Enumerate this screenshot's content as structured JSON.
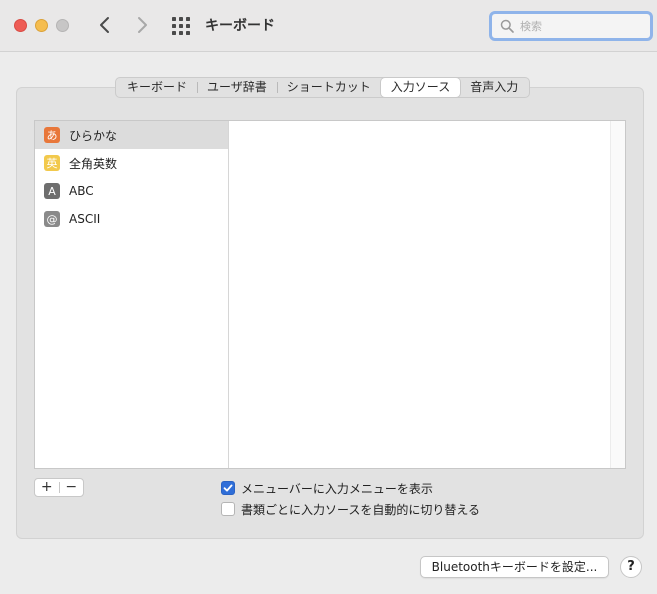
{
  "window": {
    "title": "キーボード"
  },
  "search": {
    "placeholder": "検索",
    "value": ""
  },
  "tabs": [
    {
      "label": "キーボード",
      "active": false
    },
    {
      "label": "ユーザ辞書",
      "active": false
    },
    {
      "label": "ショートカット",
      "active": false
    },
    {
      "label": "入力ソース",
      "active": true
    },
    {
      "label": "音声入力",
      "active": false
    }
  ],
  "input_sources": [
    {
      "label": "ひらかな",
      "icon": "hiragana-icon",
      "glyph": "あ",
      "color": "#e8773a",
      "selected": true
    },
    {
      "label": "全角英数",
      "icon": "zenkaku-icon",
      "glyph": "英",
      "color": "#f2c94c",
      "selected": false
    },
    {
      "label": "ABC",
      "icon": "abc-icon",
      "glyph": "A",
      "color": "#6e6e6e",
      "selected": false
    },
    {
      "label": "ASCII",
      "icon": "ascii-icon",
      "glyph": "@",
      "color": "#8a8a8a",
      "selected": false
    }
  ],
  "buttons": {
    "add": "+",
    "remove": "−",
    "bluetooth": "Bluetoothキーボードを設定...",
    "help": "?"
  },
  "options": {
    "show_menu": {
      "label": "メニューバーに入力メニューを表示",
      "checked": true
    },
    "auto_switch": {
      "label": "書類ごとに入力ソースを自動的に切り替える",
      "checked": false
    }
  }
}
